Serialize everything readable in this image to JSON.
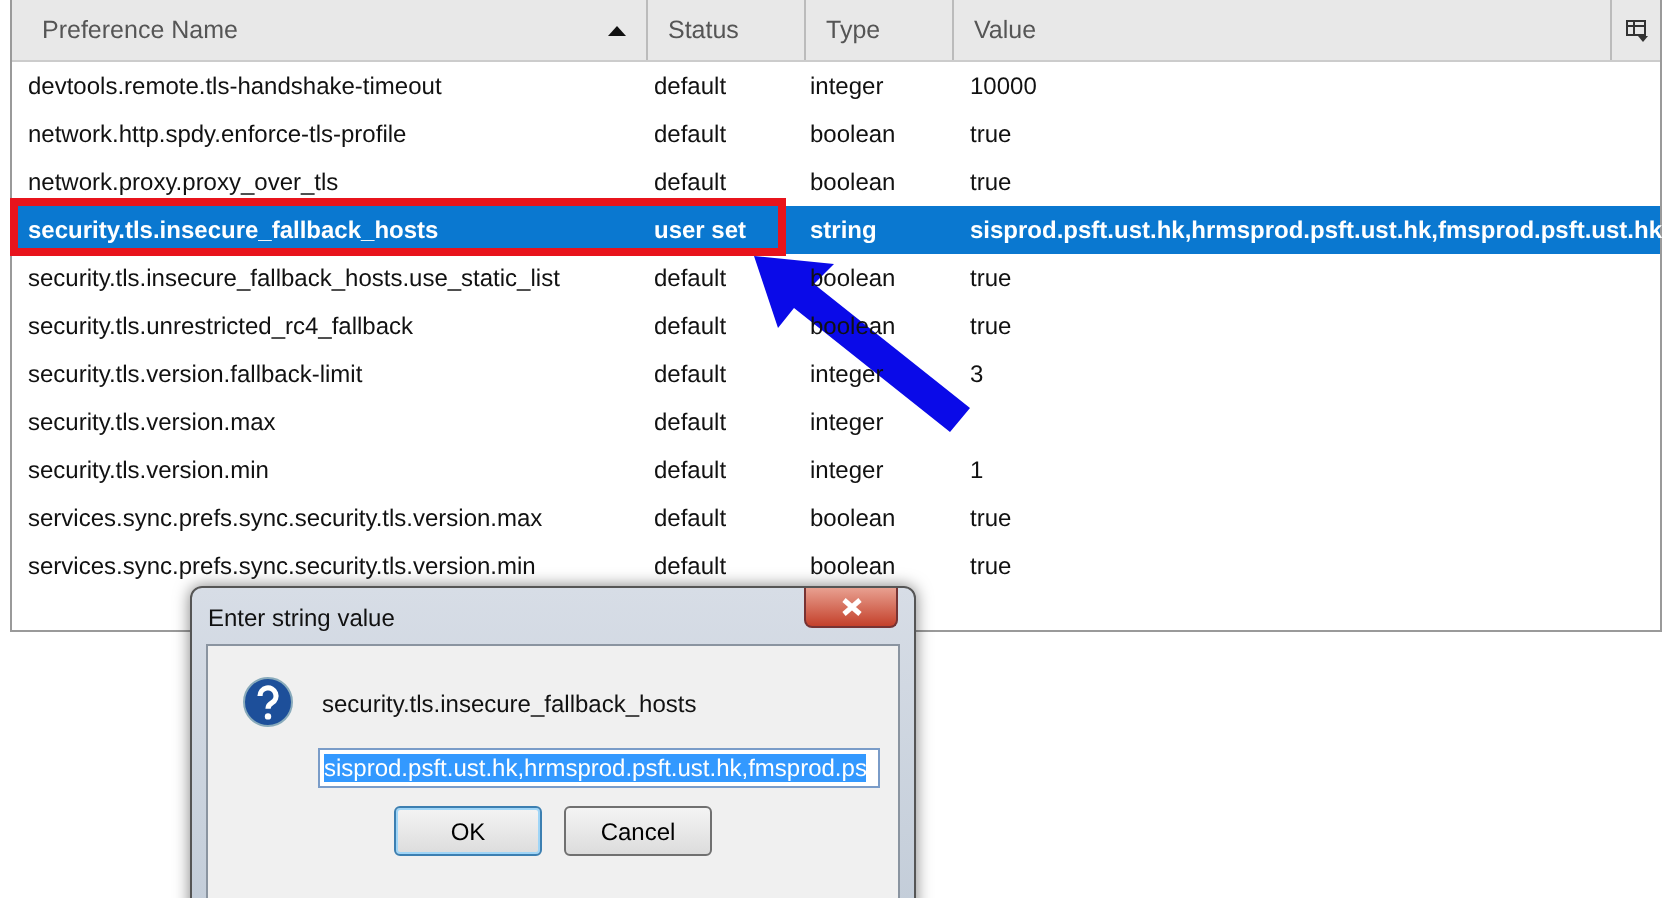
{
  "table": {
    "columns": [
      {
        "label": "Preference Name",
        "sorted": true
      },
      {
        "label": "Status",
        "sorted": false
      },
      {
        "label": "Type",
        "sorted": false
      },
      {
        "label": "Value",
        "sorted": false
      }
    ],
    "rows": [
      {
        "name": "devtools.remote.tls-handshake-timeout",
        "status": "default",
        "type": "integer",
        "value": "10000",
        "selected": false
      },
      {
        "name": "network.http.spdy.enforce-tls-profile",
        "status": "default",
        "type": "boolean",
        "value": "true",
        "selected": false
      },
      {
        "name": "network.proxy.proxy_over_tls",
        "status": "default",
        "type": "boolean",
        "value": "true",
        "selected": false
      },
      {
        "name": "security.tls.insecure_fallback_hosts",
        "status": "user set",
        "type": "string",
        "value": "sisprod.psft.ust.hk,hrmsprod.psft.ust.hk,fmsprod.psft.ust.hk",
        "selected": true
      },
      {
        "name": "security.tls.insecure_fallback_hosts.use_static_list",
        "status": "default",
        "type": "boolean",
        "value": "true",
        "selected": false
      },
      {
        "name": "security.tls.unrestricted_rc4_fallback",
        "status": "default",
        "type": "boolean",
        "value": "true",
        "selected": false
      },
      {
        "name": "security.tls.version.fallback-limit",
        "status": "default",
        "type": "integer",
        "value": "3",
        "selected": false
      },
      {
        "name": "security.tls.version.max",
        "status": "default",
        "type": "integer",
        "selected": false
      },
      {
        "name": "security.tls.version.min",
        "status": "default",
        "type": "integer",
        "value": "1",
        "selected": false
      },
      {
        "name": "services.sync.prefs.sync.security.tls.version.max",
        "status": "default",
        "type": "boolean",
        "value": "true",
        "selected": false
      },
      {
        "name": "services.sync.prefs.sync.security.tls.version.min",
        "status": "default",
        "type": "boolean",
        "value": "true",
        "selected": false
      }
    ]
  },
  "dialog": {
    "title": "Enter string value",
    "message": "security.tls.insecure_fallback_hosts",
    "value": "sisprod.psft.ust.hk,hrmsprod.psft.ust.hk,fmsprod.ps",
    "buttons": [
      "OK",
      "Cancel"
    ]
  }
}
